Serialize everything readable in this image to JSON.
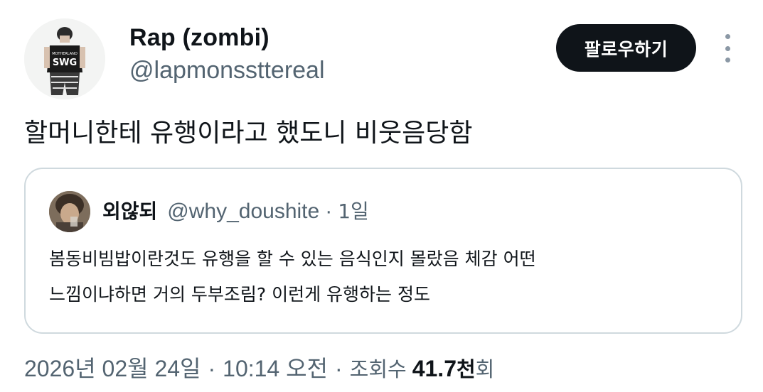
{
  "author": {
    "display_name": "Rap (zombi)",
    "handle": "@lapmonssttereal",
    "avatar_shirt_text_top": "MOTHERLAND",
    "avatar_shirt_text": "SWG"
  },
  "follow_button": {
    "label": "팔로우하기"
  },
  "more_menu": {
    "icon": "vertical-ellipsis-icon"
  },
  "tweet": {
    "text": "할머니한테 유행이라고 했도니 비웃음당함"
  },
  "quote": {
    "display_name": "외않되",
    "handle": "@why_doushite",
    "separator": "·",
    "time": "1일",
    "lines": [
      "봄동비빔밥이란것도 유행을 할 수 있는 음식인지 몰랐음 체감 어떤",
      "느낌이냐하면 거의 두부조림? 이런게 유행하는 정도"
    ]
  },
  "meta": {
    "date": "2026년 02월 24일",
    "separator": "·",
    "time": "10:14 오전",
    "views_label": "조회수",
    "views_value": "41.7",
    "views_unit": "천",
    "views_suffix": "회"
  },
  "colors": {
    "text_primary": "#0f1419",
    "text_secondary": "#536471",
    "border": "#cfd9de",
    "button_bg": "#0f1419"
  }
}
